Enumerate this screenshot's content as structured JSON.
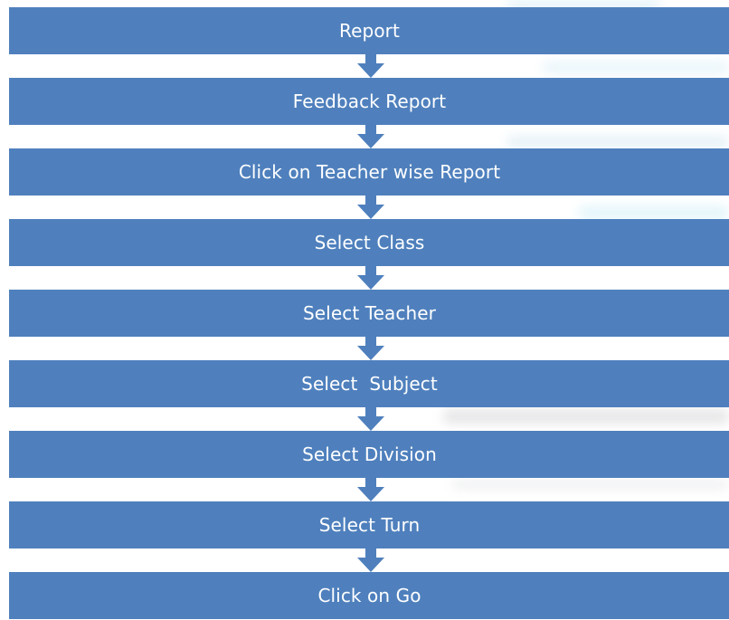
{
  "flowchart": {
    "box_color": "#4f80bd",
    "arrow_color": "#4f80bd",
    "text_color": "#ffffff",
    "steps": [
      {
        "label": "Report"
      },
      {
        "label": "Feedback Report"
      },
      {
        "label": "Click on Teacher wise Report"
      },
      {
        "label": "Select Class"
      },
      {
        "label": "Select Teacher"
      },
      {
        "label": "Select  Subject"
      },
      {
        "label": "Select Division"
      },
      {
        "label": "Select Turn"
      },
      {
        "label": "Click on Go"
      }
    ]
  }
}
